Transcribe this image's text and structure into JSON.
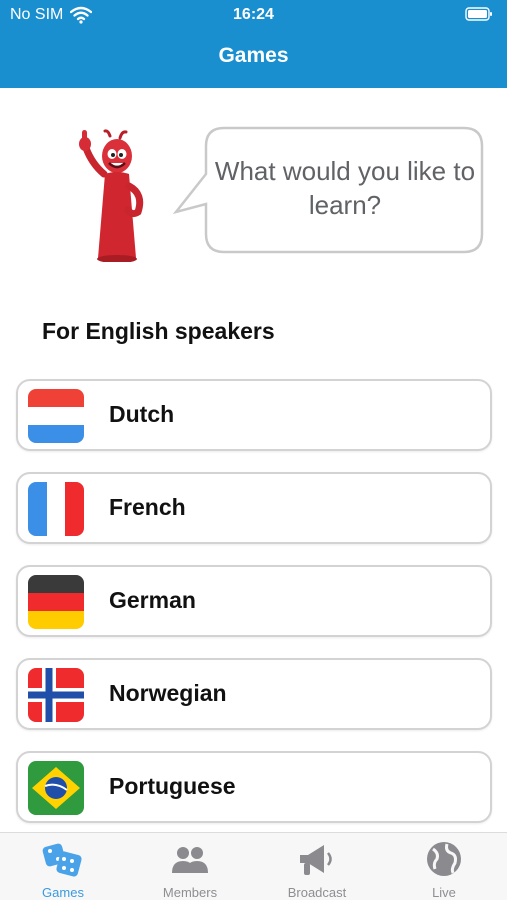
{
  "status_bar": {
    "carrier": "No SIM",
    "time": "16:24",
    "icons": [
      "wifi-icon",
      "battery-icon"
    ]
  },
  "header": {
    "title": "Games",
    "color": "#1a8fd0"
  },
  "prompt": {
    "text": "What would you like to learn?",
    "mascot": "red-mascot-character"
  },
  "section": {
    "heading": "For English speakers"
  },
  "languages": [
    {
      "label": "Dutch",
      "flag": "netherlands-flag"
    },
    {
      "label": "French",
      "flag": "france-flag"
    },
    {
      "label": "German",
      "flag": "germany-flag"
    },
    {
      "label": "Norwegian",
      "flag": "norway-flag"
    },
    {
      "label": "Portuguese",
      "flag": "brazil-flag"
    }
  ],
  "tabbar": {
    "active_color": "#3a9ae0",
    "inactive_color": "#8e8e93",
    "tabs": [
      {
        "label": "Games",
        "icon": "dice-icon",
        "active": true
      },
      {
        "label": "Members",
        "icon": "people-icon",
        "active": false
      },
      {
        "label": "Broadcast",
        "icon": "megaphone-icon",
        "active": false
      },
      {
        "label": "Live",
        "icon": "globe-icon",
        "active": false
      }
    ]
  }
}
